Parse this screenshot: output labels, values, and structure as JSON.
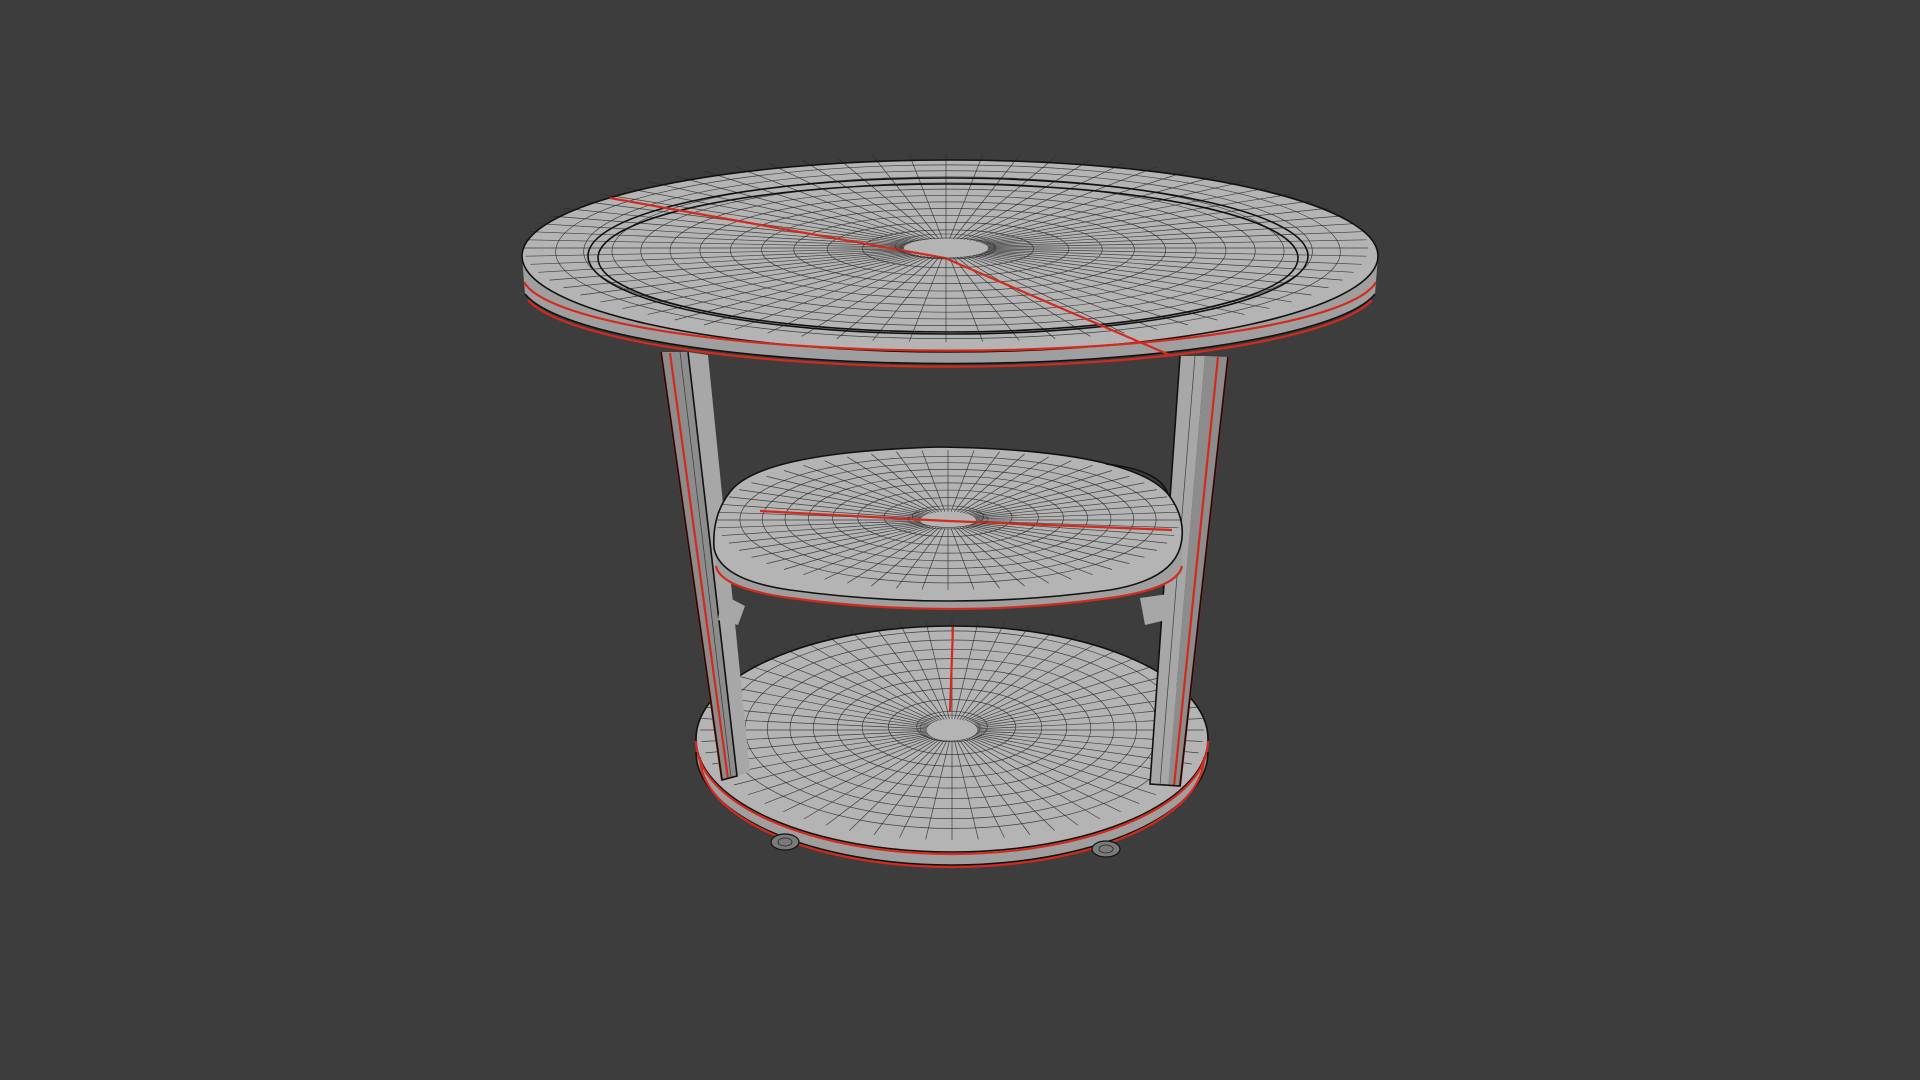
{
  "viewport": {
    "background_color": "#3d3d3d",
    "mesh_fill_color": "#b4b4b4",
    "wireframe_color": "#2a2a2a",
    "seam_color": "#d42a1e"
  },
  "scene": {
    "object": "round-side-table-wireframe",
    "parts": [
      "table-top",
      "middle-shelf",
      "bottom-base",
      "left-leg",
      "right-leg",
      "caster-left",
      "caster-right"
    ]
  }
}
